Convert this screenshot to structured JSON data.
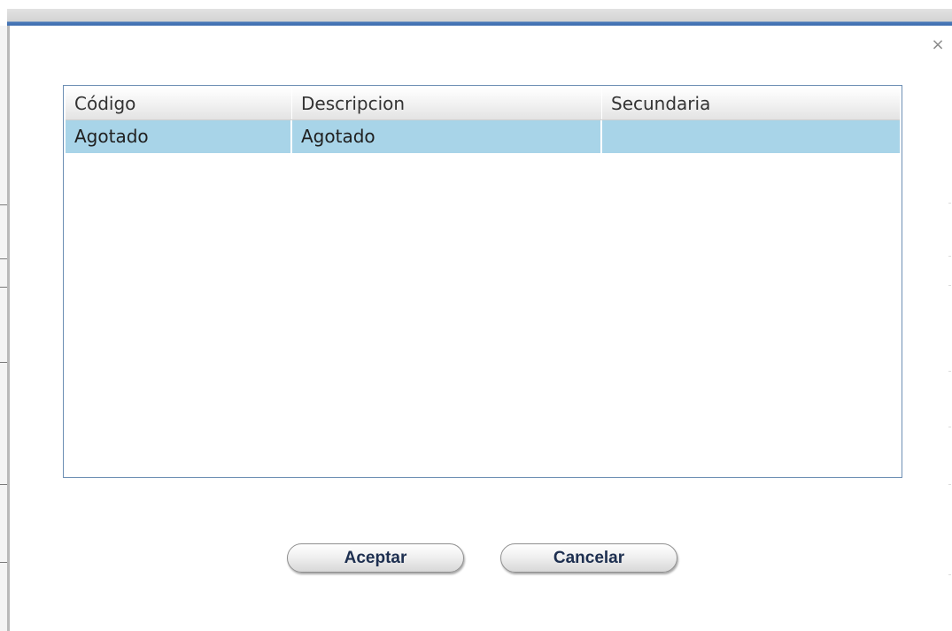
{
  "dialog": {
    "close_symbol": "×"
  },
  "grid": {
    "columns": [
      "Código",
      "Descripcion",
      "Secundaria"
    ],
    "rows": [
      {
        "codigo": "Agotado",
        "descripcion": "Agotado",
        "secundaria": ""
      }
    ],
    "selected_row_color": "#a8d4e8"
  },
  "buttons": {
    "accept_label": "Aceptar",
    "cancel_label": "Cancelar"
  },
  "colors": {
    "title_bar_accent": "#4a79b8",
    "grid_border": "#6d8fb4",
    "button_text": "#1d2f50"
  }
}
